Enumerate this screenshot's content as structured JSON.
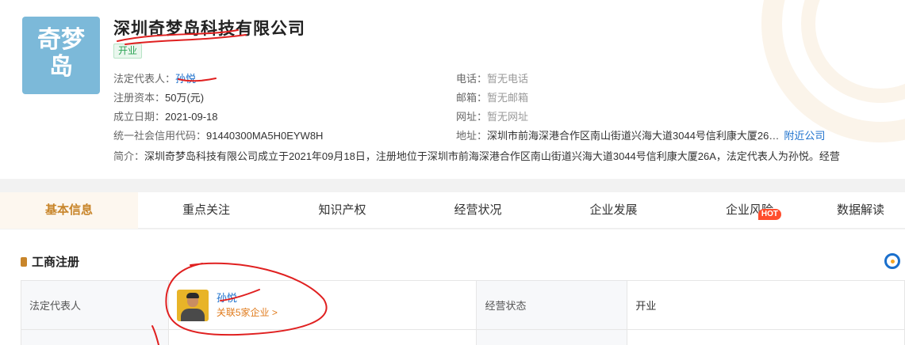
{
  "company": {
    "logo_text": [
      "奇梦",
      "岛"
    ],
    "name": "深圳奇梦岛科技有限公司",
    "status": "开业"
  },
  "info_left": [
    {
      "label": "法定代表人：",
      "value": "孙悦"
    },
    {
      "label": "注册资本：",
      "value": "50万(元)"
    },
    {
      "label": "成立日期：",
      "value": "2021-09-18"
    },
    {
      "label": "统一社会信用代码：",
      "value": "91440300MA5H0EYW8H"
    }
  ],
  "info_right": [
    {
      "label": "电话：",
      "value": "暂无电话"
    },
    {
      "label": "邮箱：",
      "value": "暂无邮箱"
    },
    {
      "label": "网址：",
      "value": "暂无网址"
    },
    {
      "label": "地址：",
      "value": "深圳市前海深港合作区南山街道兴海大道3044号信利康大厦26…",
      "extra": "附近公司"
    }
  ],
  "intro": {
    "label": "简介：",
    "value": "深圳奇梦岛科技有限公司成立于2021年09月18日，注册地位于深圳市前海深港合作区南山街道兴海大道3044号信利康大厦26A，法定代表人为孙悦。经营"
  },
  "tabs": [
    {
      "label": "基本信息"
    },
    {
      "label": "重点关注"
    },
    {
      "label": "知识产权"
    },
    {
      "label": "经营状况"
    },
    {
      "label": "企业发展"
    },
    {
      "label": "企业风险",
      "badge": "HOT"
    },
    {
      "label": "数据解读"
    }
  ],
  "section": {
    "title": "工商注册",
    "rows": [
      {
        "label1": "法定代表人",
        "person_name": "孙悦",
        "person_link": "关联5家企业 >",
        "label2": "经营状态",
        "value2": "开业"
      }
    ]
  },
  "colors": {
    "accent": "#c8852a",
    "link": "#1a6fcc",
    "status_green": "#2aa353",
    "annotation_red": "#e02020"
  }
}
